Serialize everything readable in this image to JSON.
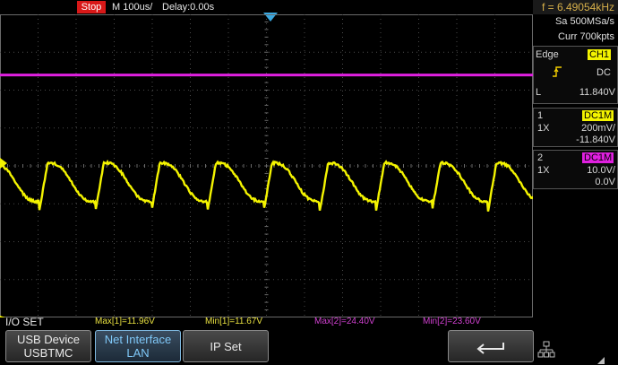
{
  "topbar": {
    "run_state": "Stop",
    "timebase": "M 100us/",
    "delay": "Delay:0.00s"
  },
  "panel": {
    "frequency": "f = 6.49054kHz",
    "sample_rate": "Sa 500MSa/s",
    "memory": "Curr 700kpts",
    "trigger": {
      "mode_label": "Edge",
      "source": "CH1",
      "slope_icon": "rising-edge-icon",
      "coupling": "DC",
      "level_label": "L",
      "level": "11.840V"
    },
    "ch1": {
      "number": "1",
      "coupling": "DC1M",
      "probe": "1X",
      "scale": "200mV/",
      "offset": "-11.840V",
      "color": "#f4f400"
    },
    "ch2": {
      "number": "2",
      "coupling": "DC1M",
      "probe": "1X",
      "scale": "10.0V/",
      "offset": "0.0V",
      "color": "#e020e0"
    }
  },
  "waveforms": {
    "ch1": {
      "color": "#f4f400",
      "cycles_visible": 9.5,
      "center_fraction": 0.57,
      "amplitude_fraction": 0.08
    },
    "ch2": {
      "color": "#e020e0",
      "level_fraction": 0.2
    }
  },
  "measurements": {
    "menu_title": "I/O SET",
    "items": [
      {
        "label": "Max[1]=11.96V",
        "color": "#e8e040"
      },
      {
        "label": "Min[1]=11.67V",
        "color": "#e8e040"
      },
      {
        "label": "Max[2]=24.40V",
        "color": "#d040d0"
      },
      {
        "label": "Min[2]=23.60V",
        "color": "#d040d0"
      }
    ]
  },
  "softkeys": {
    "usb_device_line1": "USB Device",
    "usb_device_line2": "USBTMC",
    "net_interface_line1": "Net Interface",
    "net_interface_line2": "LAN",
    "ip_set": "IP Set",
    "back_icon": "return-arrow-icon",
    "network_icon": "network-icon"
  }
}
